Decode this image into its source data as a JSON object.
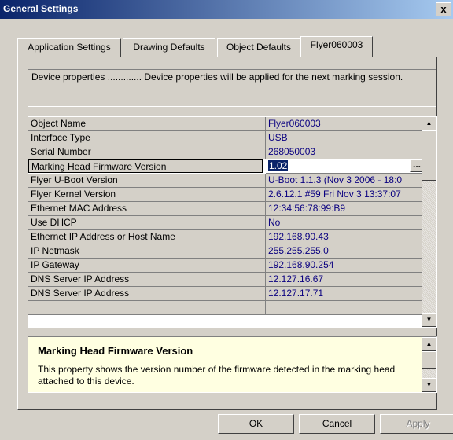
{
  "window": {
    "title": "General Settings",
    "close_label": "x"
  },
  "tabs": [
    {
      "label": "Application Settings"
    },
    {
      "label": "Drawing Defaults"
    },
    {
      "label": "Object Defaults"
    },
    {
      "label": "Flyer060003"
    }
  ],
  "description": "Device properties ............. Device properties will be applied for the next marking session.",
  "properties": [
    {
      "name": "Object Name",
      "value": "Flyer060003"
    },
    {
      "name": "Interface Type",
      "value": "USB"
    },
    {
      "name": "Serial Number",
      "value": "268050003"
    },
    {
      "name": "Marking Head Firmware Version",
      "value": "1.02"
    },
    {
      "name": "Flyer U-Boot Version",
      "value": "U-Boot 1.1.3 (Nov  3 2006 - 18:0"
    },
    {
      "name": "Flyer Kernel Version",
      "value": "2.6.12.1 #59 Fri Nov 3 13:37:07"
    },
    {
      "name": "Ethernet MAC Address",
      "value": "12:34:56:78:99:B9"
    },
    {
      "name": "Use DHCP",
      "value": "No"
    },
    {
      "name": "Ethernet IP Address or Host Name",
      "value": "192.168.90.43"
    },
    {
      "name": "IP Netmask",
      "value": "255.255.255.0"
    },
    {
      "name": "IP Gateway",
      "value": "192.168.90.254"
    },
    {
      "name": "DNS Server IP Address",
      "value": "12.127.16.67"
    },
    {
      "name": "DNS Server IP Address",
      "value": "12.127.17.71"
    }
  ],
  "help": {
    "title": "Marking Head Firmware Version",
    "text": "This property shows the version number of the firmware detected in the marking head attached to this device."
  },
  "buttons": {
    "ok": "OK",
    "cancel": "Cancel",
    "apply": "Apply"
  }
}
